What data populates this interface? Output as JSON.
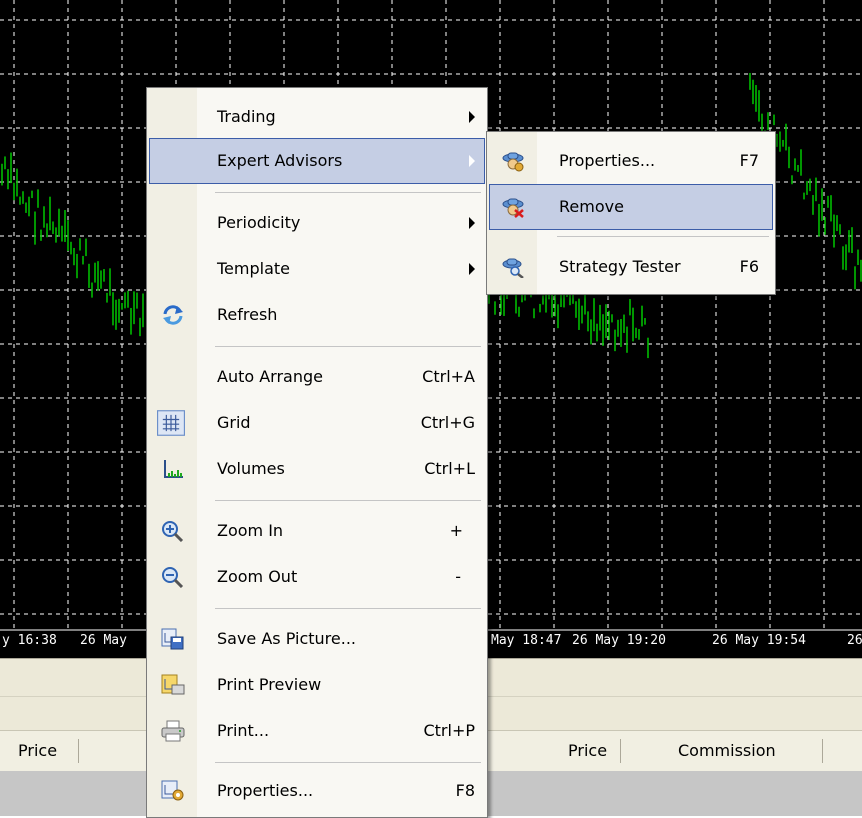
{
  "chart": {
    "time_labels": [
      "y 16:38",
      "26 May",
      "May 18:47",
      "26 May 19:20",
      "26 May 19:54",
      "26"
    ]
  },
  "terminal": {
    "columns_left": [
      "Price"
    ],
    "columns_right": [
      "Price",
      "Commission"
    ]
  },
  "context_menu": {
    "items": [
      {
        "label": "Trading",
        "submenu": true
      },
      {
        "label": "Expert Advisors",
        "submenu": true,
        "highlighted": true
      },
      {
        "label": "Periodicity",
        "submenu": true
      },
      {
        "label": "Template",
        "submenu": true
      },
      {
        "label": "Refresh",
        "icon": "refresh-icon"
      },
      {
        "label": "Auto Arrange",
        "shortcut": "Ctrl+A"
      },
      {
        "label": "Grid",
        "shortcut": "Ctrl+G",
        "icon": "grid-icon",
        "checked": true
      },
      {
        "label": "Volumes",
        "shortcut": "Ctrl+L",
        "icon": "volumes-icon"
      },
      {
        "label": "Zoom In",
        "shortcut": "+",
        "icon": "zoom-in-icon"
      },
      {
        "label": "Zoom Out",
        "shortcut": "-",
        "icon": "zoom-out-icon"
      },
      {
        "label": "Save As Picture...",
        "icon": "save-picture-icon"
      },
      {
        "label": "Print Preview",
        "icon": "print-preview-icon"
      },
      {
        "label": "Print...",
        "shortcut": "Ctrl+P",
        "icon": "printer-icon"
      },
      {
        "label": "Properties...",
        "shortcut": "F8",
        "icon": "chart-properties-icon"
      }
    ]
  },
  "submenu": {
    "items": [
      {
        "label": "Properties...",
        "shortcut": "F7",
        "icon": "expert-properties-icon"
      },
      {
        "label": "Remove",
        "icon": "expert-remove-icon",
        "highlighted": true
      },
      {
        "label": "Strategy Tester",
        "shortcut": "F6",
        "icon": "strategy-tester-icon"
      }
    ]
  },
  "colors": {
    "chart_background": "#000000",
    "bar_color": "#00c800",
    "grid_color": "#ffffff",
    "menu_highlight": "#c5cee4",
    "menu_highlight_border": "#3c5da8"
  }
}
